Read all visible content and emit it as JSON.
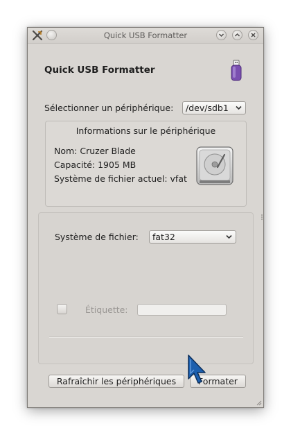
{
  "window": {
    "title": "Quick USB Formatter",
    "buttons": [
      "minimize-icon",
      "maximize-icon",
      "close-icon"
    ]
  },
  "header": {
    "title": "Quick USB Formatter",
    "icon": "usb-drive-icon"
  },
  "device": {
    "select_label": "Sélectionner un périphérique:",
    "selected": "/dev/sdb1"
  },
  "info": {
    "title": "Informations sur le périphérique",
    "name_line": "Nom: Cruzer Blade",
    "capacity_line": "Capacité: 1905 MB",
    "filesystem_line": "Système de fichier actuel: vfat",
    "icon": "hard-drive-icon"
  },
  "format": {
    "filesystem_label": "Système de fichier:",
    "filesystem_selected": "fat32",
    "label_checkbox_checked": false,
    "label_text": "Étiquette:",
    "label_value": ""
  },
  "actions": {
    "refresh_label": "Rafraîchir les périphériques",
    "format_label": "Formater"
  }
}
